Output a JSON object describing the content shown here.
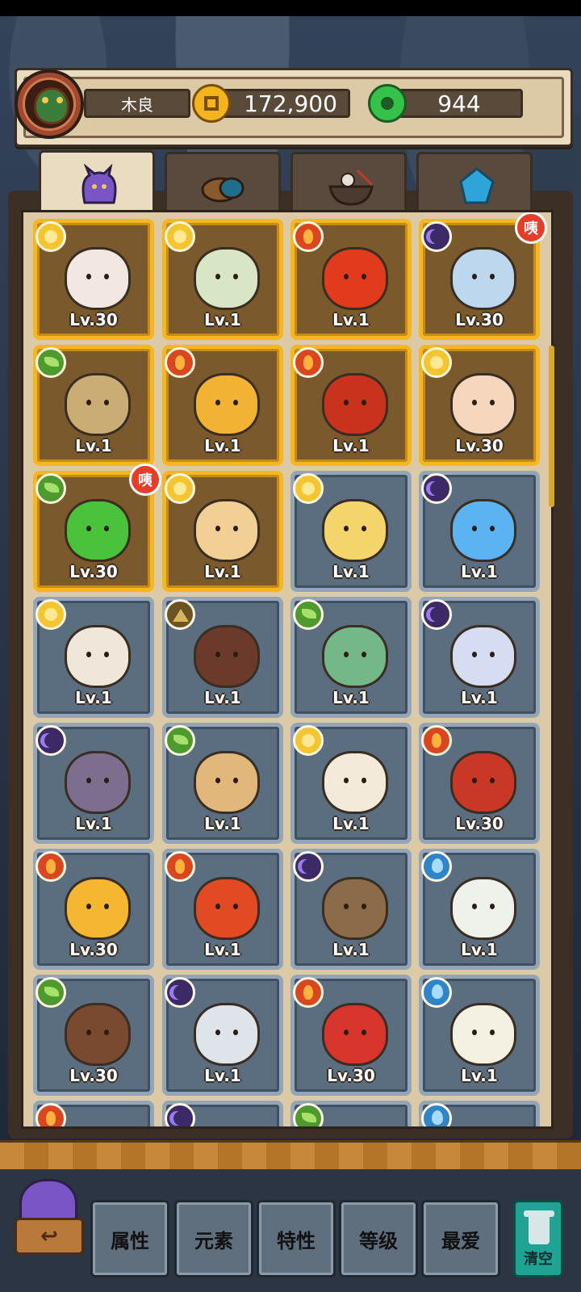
{
  "player": {
    "name": "木良",
    "coins": "172,900",
    "gems": "944"
  },
  "colors": {
    "gold_card": "#f5b721",
    "slate_card": "#93a5b7"
  },
  "tabs": [
    {
      "icon": "purple-monster-icon",
      "active": true
    },
    {
      "icon": "drum-shell-icon",
      "active": false
    },
    {
      "icon": "noodle-bowl-icon",
      "active": false
    },
    {
      "icon": "blue-crystal-icon",
      "active": false
    }
  ],
  "cards": [
    {
      "element": "sun",
      "level": "Lv.30",
      "frame": "gold",
      "color": "#f3e7e2",
      "badge": ""
    },
    {
      "element": "sun",
      "level": "Lv.1",
      "frame": "gold",
      "color": "#d9e6c5",
      "badge": ""
    },
    {
      "element": "fire",
      "level": "Lv.1",
      "frame": "gold",
      "color": "#e23a1c",
      "badge": ""
    },
    {
      "element": "moon",
      "level": "Lv.30",
      "frame": "gold",
      "color": "#bcd7ee",
      "badge": "咦"
    },
    {
      "element": "leaf",
      "level": "Lv.1",
      "frame": "gold",
      "color": "#c9ad74",
      "badge": ""
    },
    {
      "element": "fire",
      "level": "Lv.1",
      "frame": "gold",
      "color": "#f2b233",
      "badge": ""
    },
    {
      "element": "fire",
      "level": "Lv.1",
      "frame": "gold",
      "color": "#c9331d",
      "badge": ""
    },
    {
      "element": "sun",
      "level": "Lv.30",
      "frame": "gold",
      "color": "#f6d7bd",
      "badge": ""
    },
    {
      "element": "leaf",
      "level": "Lv.30",
      "frame": "gold",
      "color": "#4bc23b",
      "badge": "咦"
    },
    {
      "element": "sun",
      "level": "Lv.1",
      "frame": "gold",
      "color": "#f2cf94",
      "badge": ""
    },
    {
      "element": "sun",
      "level": "Lv.1",
      "frame": "slate",
      "color": "#f3d56b",
      "badge": ""
    },
    {
      "element": "moon",
      "level": "Lv.1",
      "frame": "slate",
      "color": "#5cb3f2",
      "badge": ""
    },
    {
      "element": "sun",
      "level": "Lv.1",
      "frame": "slate",
      "color": "#f1e6da",
      "badge": ""
    },
    {
      "element": "earth",
      "level": "Lv.1",
      "frame": "slate",
      "color": "#6b3a2a",
      "badge": ""
    },
    {
      "element": "leaf",
      "level": "Lv.1",
      "frame": "slate",
      "color": "#74b889",
      "badge": ""
    },
    {
      "element": "moon",
      "level": "Lv.1",
      "frame": "slate",
      "color": "#d6dcf2",
      "badge": ""
    },
    {
      "element": "moon",
      "level": "Lv.1",
      "frame": "slate",
      "color": "#7d6d8e",
      "badge": ""
    },
    {
      "element": "leaf",
      "level": "Lv.1",
      "frame": "slate",
      "color": "#e1b77c",
      "badge": ""
    },
    {
      "element": "sun",
      "level": "Lv.1",
      "frame": "slate",
      "color": "#f4ead9",
      "badge": ""
    },
    {
      "element": "fire",
      "level": "Lv.30",
      "frame": "slate",
      "color": "#c93727",
      "badge": ""
    },
    {
      "element": "fire",
      "level": "Lv.30",
      "frame": "slate",
      "color": "#f5b731",
      "badge": ""
    },
    {
      "element": "fire",
      "level": "Lv.1",
      "frame": "slate",
      "color": "#e24a24",
      "badge": ""
    },
    {
      "element": "moon",
      "level": "Lv.1",
      "frame": "slate",
      "color": "#8b6b4a",
      "badge": ""
    },
    {
      "element": "water",
      "level": "Lv.1",
      "frame": "slate",
      "color": "#eef2ea",
      "badge": ""
    },
    {
      "element": "leaf",
      "level": "Lv.30",
      "frame": "slate",
      "color": "#7a4a30",
      "badge": ""
    },
    {
      "element": "moon",
      "level": "Lv.1",
      "frame": "slate",
      "color": "#dfe4ea",
      "badge": ""
    },
    {
      "element": "fire",
      "level": "Lv.30",
      "frame": "slate",
      "color": "#d8352c",
      "badge": ""
    },
    {
      "element": "water",
      "level": "Lv.1",
      "frame": "slate",
      "color": "#f4f0e2",
      "badge": ""
    },
    {
      "element": "fire",
      "level": "",
      "frame": "slate",
      "color": "#5b6e80",
      "badge": ""
    },
    {
      "element": "moon",
      "level": "",
      "frame": "slate",
      "color": "#5b6e80",
      "badge": ""
    },
    {
      "element": "leaf",
      "level": "",
      "frame": "slate",
      "color": "#5b6e80",
      "badge": ""
    },
    {
      "element": "water",
      "level": "",
      "frame": "slate",
      "color": "#5b6e80",
      "badge": ""
    }
  ],
  "bottom": {
    "back_label": "↩",
    "sort_buttons": [
      "属性",
      "元素",
      "特性",
      "等级",
      "最爱"
    ],
    "clear_label": "清空"
  }
}
